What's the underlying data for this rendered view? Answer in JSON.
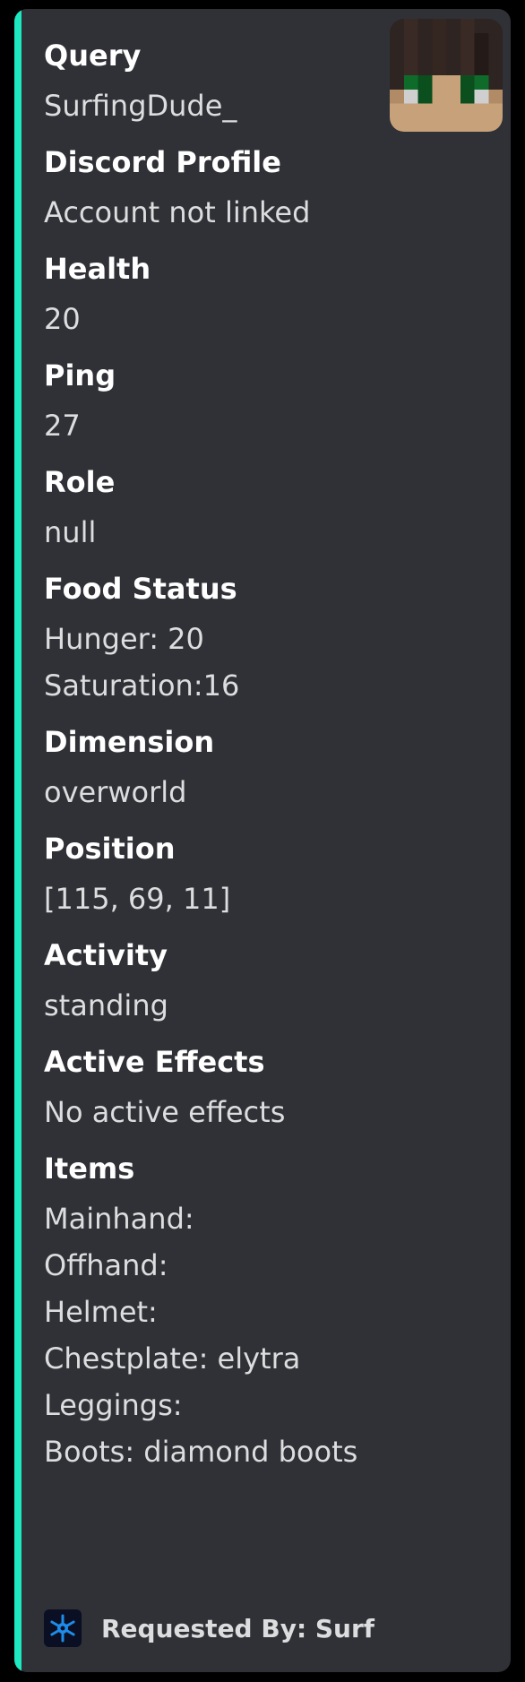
{
  "embed": {
    "accent_color": "#1ee8c0",
    "thumbnail_icon": "minecraft-player-head-icon",
    "fields": [
      {
        "name": "Query",
        "lines": [
          "SurfingDude_"
        ]
      },
      {
        "name": "Discord Profile",
        "lines": [
          "Account not linked"
        ]
      },
      {
        "name": "Health",
        "lines": [
          "20"
        ]
      },
      {
        "name": "Ping",
        "lines": [
          "27"
        ]
      },
      {
        "name": "Role",
        "lines": [
          "null"
        ]
      },
      {
        "name": "Food Status",
        "lines": [
          "Hunger: 20",
          "Saturation:16"
        ]
      },
      {
        "name": "Dimension",
        "lines": [
          "overworld"
        ]
      },
      {
        "name": "Position",
        "lines": [
          "[115, 69, 11]"
        ]
      },
      {
        "name": "Activity",
        "lines": [
          "standing"
        ]
      },
      {
        "name": "Active Effects",
        "lines": [
          "No active effects"
        ]
      },
      {
        "name": "Items",
        "lines": [
          "Mainhand:",
          "Offhand:",
          "Helmet:",
          "Chestplate: elytra",
          "Leggings:",
          "Boots: diamond boots"
        ]
      }
    ],
    "footer": {
      "icon": "snowflake-icon",
      "text": "Requested By: Surf"
    }
  }
}
